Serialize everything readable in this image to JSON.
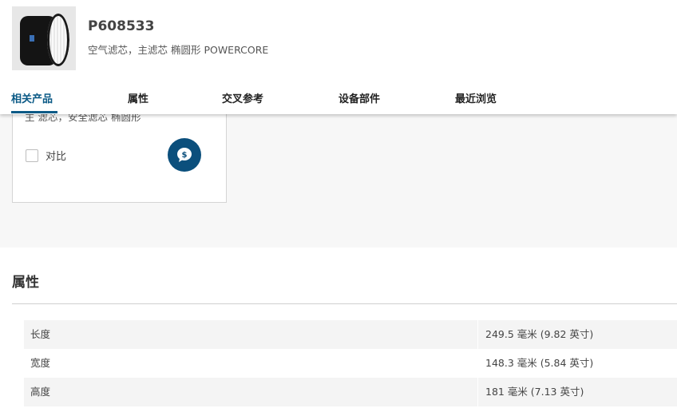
{
  "product": {
    "part_number": "P608533",
    "description": "空气滤芯，主滤芯 椭圆形 POWERCORE",
    "image_icon": "filter-product-image"
  },
  "tabs": [
    {
      "label": "相关产品",
      "active": true
    },
    {
      "label": "属性",
      "active": false
    },
    {
      "label": "交叉参考",
      "active": false
    },
    {
      "label": "设备部件",
      "active": false
    },
    {
      "label": "最近浏览",
      "active": false
    }
  ],
  "related_card": {
    "description": "主 滤芯，安全滤芯 椭圆形",
    "compare_label": "对比",
    "quote_icon": "dollar-chat-icon"
  },
  "attributes": {
    "title": "属性",
    "rows": [
      {
        "name": "长度",
        "value": "249.5 毫米 (9.82 英寸)"
      },
      {
        "name": "宽度",
        "value": "148.3 毫米 (5.84 英寸)"
      },
      {
        "name": "高度",
        "value": "181 毫米 (7.13 英寸)"
      }
    ]
  },
  "colors": {
    "accent": "#0b5a86",
    "quote_button": "#0b4f7c",
    "section_bg": "#f7f7f7",
    "row_bg": "#f4f4f4"
  }
}
